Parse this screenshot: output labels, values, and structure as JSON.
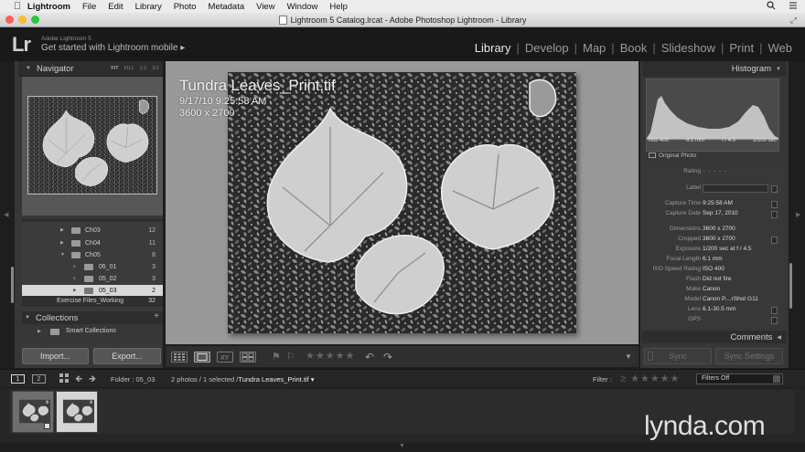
{
  "menubar": {
    "items": [
      "Lightroom",
      "File",
      "Edit",
      "Library",
      "Photo",
      "Metadata",
      "View",
      "Window",
      "Help"
    ]
  },
  "window": {
    "title": "Lightroom 5 Catalog.lrcat - Adobe Photoshop Lightroom - Library"
  },
  "identity": {
    "logo": "Lr",
    "version": "Adobe Lightroom 5",
    "mobile": "Get started with Lightroom mobile ▸"
  },
  "modules": {
    "library": "Library",
    "develop": "Develop",
    "map": "Map",
    "book": "Book",
    "slideshow": "Slideshow",
    "print": "Print",
    "web": "Web"
  },
  "navigator": {
    "title": "Navigator",
    "zoom": {
      "fit": "FIT",
      "fill": "FILL",
      "one": "1:1",
      "three": "3:1"
    }
  },
  "folders": [
    {
      "name": "Ch03",
      "count": "12"
    },
    {
      "name": "Ch04",
      "count": "11"
    },
    {
      "name": "Ch05",
      "count": "8"
    },
    {
      "name": "05_01",
      "count": "3"
    },
    {
      "name": "05_02",
      "count": "3"
    },
    {
      "name": "05_03",
      "count": "2"
    }
  ],
  "exfiles": {
    "name": "Exercise Files_Working",
    "count": "32"
  },
  "collections": {
    "title": "Collections",
    "plus": "+",
    "smart": "Smart Collections"
  },
  "buttons": {
    "import": "Import...",
    "export": "Export...",
    "sync": "Sync",
    "sync_settings": "Sync Settings"
  },
  "loupe": {
    "filename": "Tundra Leaves_Print.tif",
    "datetime": "9/17/10 9:25:58 AM",
    "dims": "3600 x 2700"
  },
  "toolbar": {
    "stars": "★★★★★",
    "stars_count": 0
  },
  "histogram": {
    "title": "Histogram",
    "iso": "ISO 400",
    "focal": "6.1 mm",
    "aperture": "f / 4.5",
    "shutter": "1/200 sec",
    "original": "Original Photo"
  },
  "metadata": [
    {
      "key": "Rating",
      "value": "· · · · ·"
    },
    {
      "key": "Label",
      "value": ""
    },
    {
      "key": "Capture Time",
      "value": "9:25:58 AM"
    },
    {
      "key": "Capture Date",
      "value": "Sep 17, 2010"
    },
    {
      "key": "Dimensions",
      "value": "3600 x 2700"
    },
    {
      "key": "Cropped",
      "value": "3600 x 2700"
    },
    {
      "key": "Exposure",
      "value": "1/200 sec at f / 4.5"
    },
    {
      "key": "Focal Length",
      "value": "6.1 mm"
    },
    {
      "key": "ISO Speed Rating",
      "value": "ISO 400"
    },
    {
      "key": "Flash",
      "value": "Did not fire"
    },
    {
      "key": "Make",
      "value": "Canon"
    },
    {
      "key": "Model",
      "value": "Canon P....rShot G11"
    },
    {
      "key": "Lens",
      "value": "6.1-30.5 mm"
    },
    {
      "key": "GPS",
      "value": ""
    }
  ],
  "comments": {
    "title": "Comments"
  },
  "filmstrip": {
    "screen1": "1",
    "screen2": "2",
    "folder": "Folder : 05_03",
    "count_prefix": "2 photos / 1 selected /",
    "filename": "Tundra Leaves_Print.tif ▾",
    "filter_label": "Filter :",
    "filter_stars": "≥ ★★★★★",
    "filter_value": "Filters Off"
  },
  "watermark": "lynda.com",
  "icons": {
    "search": "search-icon",
    "menu": "list-icon"
  }
}
